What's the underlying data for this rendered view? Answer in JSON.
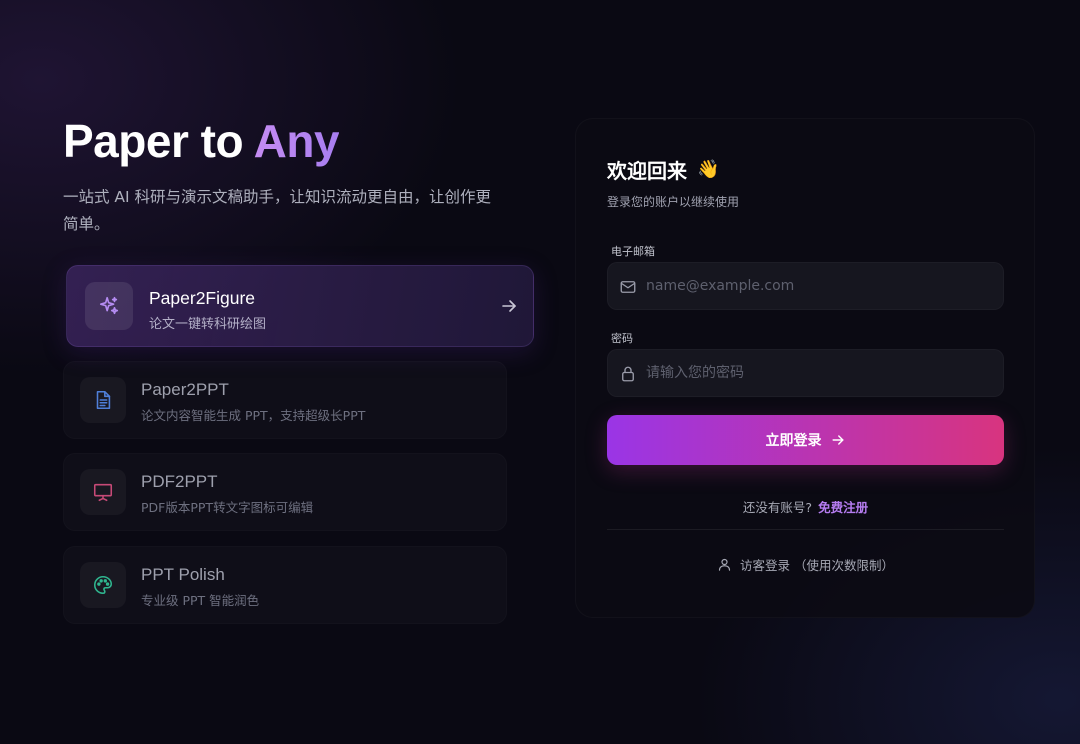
{
  "hero": {
    "title_main": "Paper to ",
    "title_accent": "Any",
    "subtitle": "一站式 AI 科研与演示文稿助手，让知识流动更自由，让创作更简单。"
  },
  "features": [
    {
      "title": "Paper2Figure",
      "desc": "论文一键转科研绘图",
      "icon": "sparkles-icon",
      "active": true
    },
    {
      "title": "Paper2PPT",
      "desc": "论文内容智能生成 PPT，支持超级长PPT",
      "icon": "document-icon",
      "active": false
    },
    {
      "title": "PDF2PPT",
      "desc": "PDF版本PPT转文字图标可编辑",
      "icon": "presentation-icon",
      "active": false
    },
    {
      "title": "PPT Polish",
      "desc": "专业级 PPT 智能润色",
      "icon": "palette-icon",
      "active": false
    }
  ],
  "login": {
    "welcome": "欢迎回来",
    "welcome_emoji": "👋",
    "subtitle": "登录您的账户以继续使用",
    "email_label": "电子邮箱",
    "email_placeholder": "name@example.com",
    "password_label": "密码",
    "password_placeholder": "请输入您的密码",
    "submit_label": "立即登录",
    "no_account_text": "还没有账号?",
    "signup_link": "免费注册",
    "guest_label": "访客登录 （使用次数限制）"
  },
  "colors": {
    "accent_purple": "#9a35e6",
    "accent_pink": "#d8347f",
    "link": "#b57cf0",
    "background": "#0a0913"
  }
}
